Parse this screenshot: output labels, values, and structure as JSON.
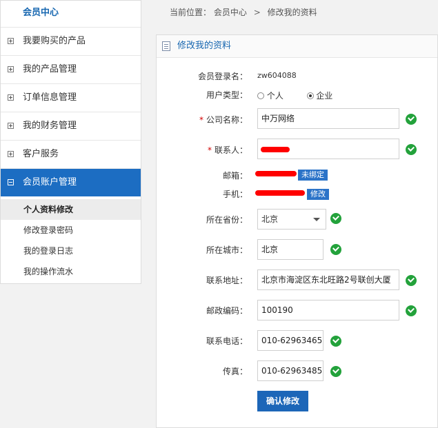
{
  "sidebar": {
    "title": "会员中心",
    "items": [
      {
        "label": "我要购买的产品",
        "toggle": "plus"
      },
      {
        "label": "我的产品管理",
        "toggle": "plus"
      },
      {
        "label": "订单信息管理",
        "toggle": "plus"
      },
      {
        "label": "我的财务管理",
        "toggle": "plus"
      },
      {
        "label": "客户服务",
        "toggle": "plus"
      },
      {
        "label": "会员账户管理",
        "toggle": "minus",
        "active": true
      }
    ],
    "subitems": [
      {
        "label": "个人资料修改",
        "current": true
      },
      {
        "label": "修改登录密码"
      },
      {
        "label": "我的登录日志"
      },
      {
        "label": "我的操作流水"
      }
    ]
  },
  "breadcrumb": {
    "prefix": "当前位置：",
    "home": "会员中心",
    "separator": ">",
    "current": "修改我的资料"
  },
  "panel": {
    "title": "修改我的资料"
  },
  "form": {
    "login_name_label": "会员登录名：",
    "login_name_value": "zw604088",
    "user_type_label": "用户类型：",
    "user_type_personal": "个人",
    "user_type_company": "企业",
    "user_type_selected": "企业",
    "company_label": "公司名称：",
    "company_value": "中万网络",
    "contact_label": "联系人：",
    "email_label": "邮箱：",
    "email_unbound": "未绑定",
    "mobile_label": "手机：",
    "mobile_modify": "修改",
    "province_label": "所在省份：",
    "province_value": "北京",
    "city_label": "所在城市：",
    "city_value": "北京",
    "address_label": "联系地址：",
    "address_value": "北京市海淀区东北旺路2号联创大厦",
    "postcode_label": "邮政编码：",
    "postcode_value": "100190",
    "phone_label": "联系电话：",
    "phone_value": "010-62963465",
    "fax_label": "传真：",
    "fax_value": "010-62963485",
    "submit_label": "确认修改"
  },
  "colors": {
    "accent": "#1c6dc2",
    "ok": "#23a23b",
    "required": "#d10000",
    "redaction": "#ff0000"
  }
}
